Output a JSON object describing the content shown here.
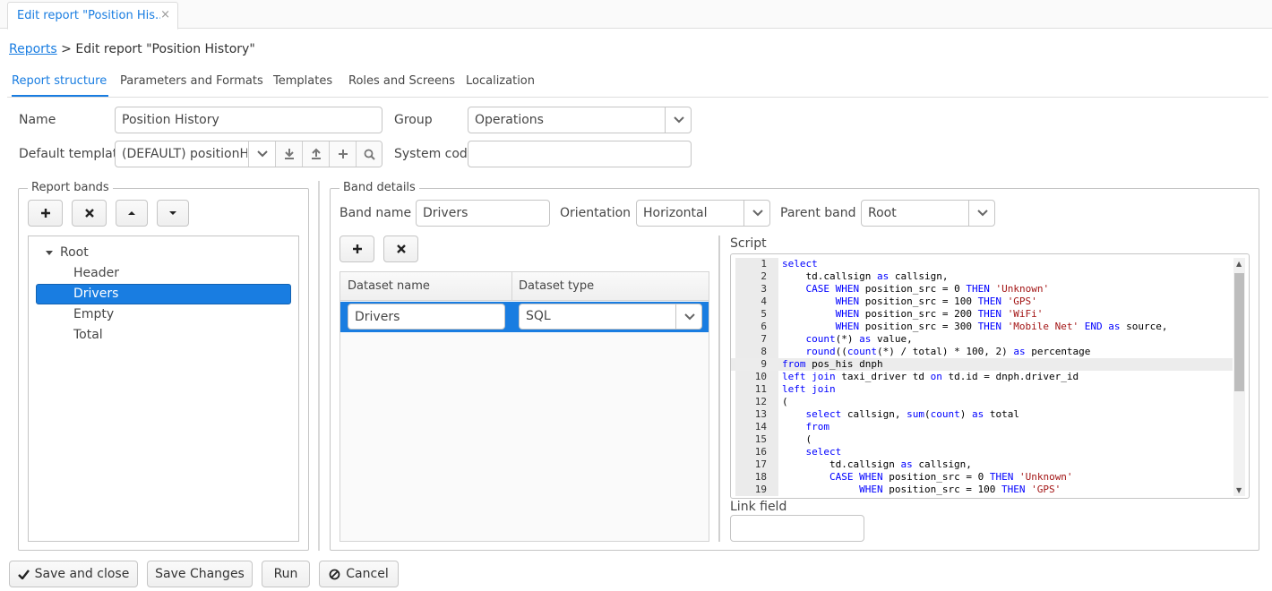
{
  "window_tab": {
    "label": "Edit report \"Position His...",
    "close": "×"
  },
  "breadcrumb": {
    "link": "Reports",
    "separator": ">",
    "current": "Edit report \"Position History\""
  },
  "tabs": [
    {
      "label": "Report structure",
      "active": true
    },
    {
      "label": "Parameters and Formats"
    },
    {
      "label": "Templates"
    },
    {
      "label": "Roles and Screens"
    },
    {
      "label": "Localization"
    }
  ],
  "form": {
    "name_label": "Name",
    "name_value": "Position History",
    "group_label": "Group",
    "group_value": "Operations",
    "default_template_label": "Default template",
    "default_template_value": "(DEFAULT) positionH",
    "system_code_label": "System code",
    "system_code_value": ""
  },
  "report_bands": {
    "legend": "Report bands",
    "tree": [
      {
        "label": "Root",
        "level": 0,
        "expanded": true
      },
      {
        "label": "Header",
        "level": 1
      },
      {
        "label": "Drivers",
        "level": 1,
        "selected": true
      },
      {
        "label": "Empty",
        "level": 1
      },
      {
        "label": "Total",
        "level": 1
      }
    ]
  },
  "band_details": {
    "legend": "Band details",
    "band_name_label": "Band name",
    "band_name_value": "Drivers",
    "orientation_label": "Orientation",
    "orientation_value": "Horizontal",
    "parent_band_label": "Parent band",
    "parent_band_value": "Root",
    "datasets": {
      "columns": [
        "Dataset name",
        "Dataset type"
      ],
      "rows": [
        {
          "name": "Drivers",
          "type": "SQL"
        }
      ]
    },
    "script_label": "Script",
    "link_field_label": "Link field",
    "link_field_value": "",
    "script_lines": [
      "select",
      "    td.callsign as callsign,",
      "    CASE WHEN position_src = 0 THEN 'Unknown'",
      "         WHEN position_src = 100 THEN 'GPS'",
      "         WHEN position_src = 200 THEN 'WiFi'",
      "         WHEN position_src = 300 THEN 'Mobile Net' END as source,",
      "    count(*) as value,",
      "    round((count(*) / total) * 100, 2) as percentage",
      "from pos_his dnph",
      "left join taxi_driver td on td.id = dnph.driver_id",
      "left join",
      "(",
      "    select callsign, sum(count) as total",
      "    from",
      "    (",
      "    select",
      "        td.callsign as callsign,",
      "        CASE WHEN position_src = 0 THEN 'Unknown'",
      "             WHEN position_src = 100 THEN 'GPS'"
    ],
    "highlighted_line": 9
  },
  "footer": {
    "save_close": "Save and close",
    "save_changes": "Save Changes",
    "run": "Run",
    "cancel": "Cancel"
  },
  "colors": {
    "accent": "#197de1",
    "border": "#c5c5c5",
    "text": "#464646"
  }
}
